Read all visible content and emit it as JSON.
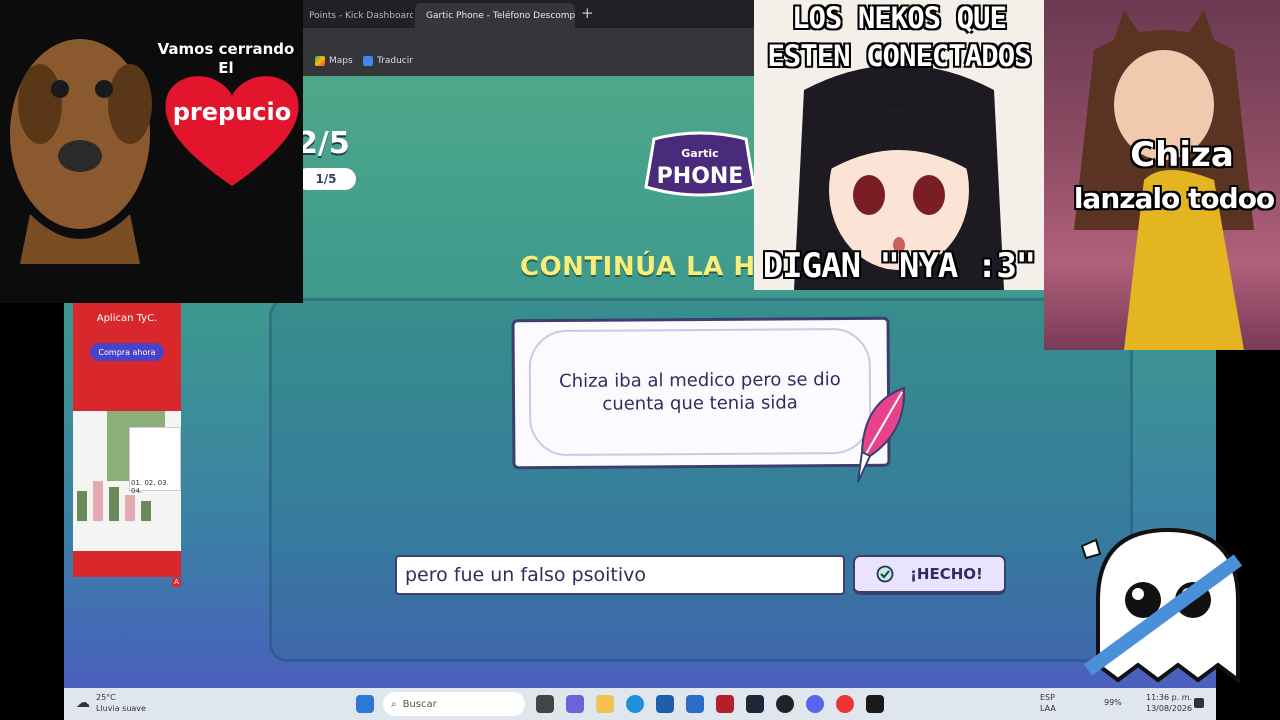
{
  "browser": {
    "tabs": [
      {
        "label": "Points - Kick Dashboard",
        "active": false
      },
      {
        "label": "Gartic Phone - Teléfono Descomp",
        "active": true
      }
    ],
    "bookmarks": [
      "Maps",
      "Traducir"
    ]
  },
  "game": {
    "round": "2/5",
    "round_pill": "1/5",
    "logo_top": "Gartic",
    "logo_main": "PHONE",
    "heading": "CONTINÚA LA H",
    "prompt_text": "Chiza iba al medico pero se dio cuenta que tenia sida",
    "answer_value": "pero fue un falso psoitivo",
    "done_label": "¡HECHO!"
  },
  "ad": {
    "text": "Aplican TyC.",
    "button": "Compra ahora",
    "chart_labels": "01. 02. 03. 04.",
    "badge": "A"
  },
  "overlays": {
    "dog_caption_1": "Vamos cerrando",
    "dog_caption_2": "El",
    "heart_text": "prepucio",
    "neko_top_1": "LOS NEKOS QUE",
    "neko_top_2": "ESTEN CONECTADOS",
    "neko_bottom": "DIGAN \"NYA :3\"",
    "cat_text_1": "Chiza",
    "cat_text_2": "lanzalo todoo"
  },
  "taskbar": {
    "weather_temp": "25°C",
    "weather_desc": "Lluvia suave",
    "search_placeholder": "Buscar",
    "lang_1": "ESP",
    "lang_2": "LAA",
    "battery": "99%",
    "time": "11:36 p. m.",
    "date": "13/08/2026"
  },
  "colors": {
    "heading": "#f7ef7a",
    "ad_red": "#d8282c",
    "card_border": "#3b3f70"
  }
}
